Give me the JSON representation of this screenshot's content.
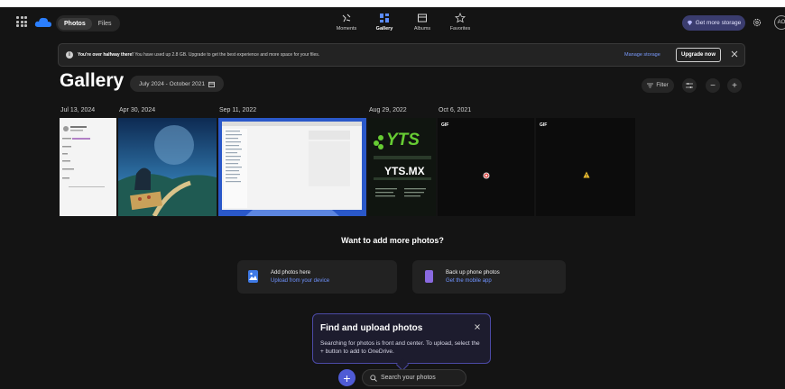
{
  "app": {
    "tabs": [
      "Photos",
      "Files"
    ],
    "active_tab": "Photos"
  },
  "nav": [
    {
      "label": "Moments",
      "icon": "moments-icon"
    },
    {
      "label": "Gallery",
      "icon": "gallery-icon",
      "active": true
    },
    {
      "label": "Albums",
      "icon": "albums-icon"
    },
    {
      "label": "Favorites",
      "icon": "star-icon"
    }
  ],
  "header": {
    "storage_label": "Get more storage",
    "avatar_initials": "AO"
  },
  "banner": {
    "bold": "You're over halfway there!",
    "text": " You have used up 2.8 GB. Upgrade to get the best experience and more space for your files.",
    "manage": "Manage storage",
    "upgrade": "Upgrade now"
  },
  "gallery": {
    "title": "Gallery",
    "range": "July 2024 - October 2021",
    "filter": "Filter",
    "dates": [
      "Jul 13, 2024",
      "Apr 30, 2024",
      "Sep 11, 2022",
      "Aug 29, 2022",
      "Oct 6, 2021"
    ],
    "gif_badge": "GIF",
    "yts_logo": "YTS",
    "yts_domain": "YTS.MX"
  },
  "empty_state": {
    "heading": "Want to add more photos?",
    "cards": [
      {
        "title": "Add photos here",
        "link": "Upload from your device"
      },
      {
        "title": "Back up phone photos",
        "link": "Get the mobile app"
      }
    ]
  },
  "popup": {
    "title": "Find and upload photos",
    "body": "Searching for photos is front and center. To upload, select the + button to add to OneDrive."
  },
  "search": {
    "placeholder": "Search your photos"
  },
  "colors": {
    "background": "#141414",
    "accent": "#4f5bd5",
    "link": "#6f93ff"
  }
}
